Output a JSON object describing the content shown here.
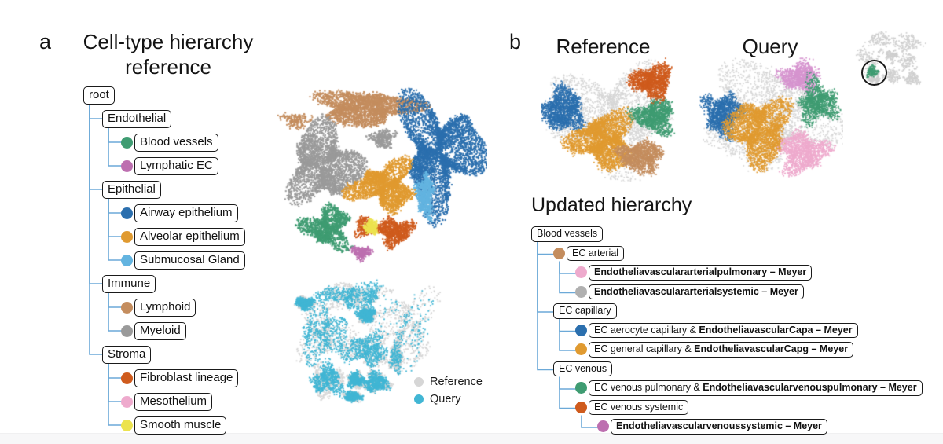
{
  "figure": {
    "panel_a_letter": "a",
    "panel_b_letter": "b",
    "title_a": "Cell-type hierarchy\nreference",
    "title_reference": "Reference",
    "title_query": "Query",
    "title_updated": "Updated hierarchy"
  },
  "legend": {
    "items": [
      {
        "label": "Reference",
        "color": "#d6d6d6"
      },
      {
        "label": "Query",
        "color": "#41b6d4"
      }
    ]
  },
  "palette": {
    "blood_vessels_green": "#3f9c72",
    "lymphatic_magenta": "#bd6fb0",
    "airway_blue": "#2b6fae",
    "alveolar_orange": "#e09a30",
    "submucosal_lightblue": "#63b4e0",
    "lymphoid_tan": "#c48d5e",
    "myeloid_gray": "#9a9a9a",
    "fibroblast_darkorange": "#cf5b1d",
    "mesothelium_pink": "#eeaacd",
    "smooth_muscle_yellow": "#ece34f",
    "ec_arterial_tan": "#c48d5e",
    "ec_arterial_pulm_pink": "#eeaacd",
    "ec_arterial_sys_gray": "#b0b0b0",
    "ec_aerocyte_blue": "#2b6fae",
    "ec_general_orange": "#e09a30",
    "ec_venous_pulm_green": "#3f9c72",
    "ec_venous_sys_orange": "#cf5b1d",
    "ec_venous_sys_meyer_magenta": "#bd6fb0",
    "tree_line": "#6ca9d8",
    "node_border": "#1a1a1a",
    "reference_gray": "#d6d6d6",
    "query_cyan": "#41b6d4"
  },
  "hierarchy_a": {
    "root": "root",
    "nodes": [
      {
        "id": "root",
        "label": "root",
        "level": 0,
        "dot": null
      },
      {
        "id": "endothelial",
        "label": "Endothelial",
        "level": 1,
        "dot": null
      },
      {
        "id": "blood",
        "label": "Blood vessels",
        "level": 2,
        "dot": "#3f9c72"
      },
      {
        "id": "lymphec",
        "label": "Lymphatic EC",
        "level": 2,
        "dot": "#bd6fb0"
      },
      {
        "id": "epithelial",
        "label": "Epithelial",
        "level": 1,
        "dot": null
      },
      {
        "id": "airway",
        "label": "Airway epithelium",
        "level": 2,
        "dot": "#2b6fae"
      },
      {
        "id": "alveolar",
        "label": "Alveolar epithelium",
        "level": 2,
        "dot": "#e09a30"
      },
      {
        "id": "submucosal",
        "label": "Submucosal Gland",
        "level": 2,
        "dot": "#63b4e0"
      },
      {
        "id": "immune",
        "label": "Immune",
        "level": 1,
        "dot": null
      },
      {
        "id": "lymphoid",
        "label": "Lymphoid",
        "level": 2,
        "dot": "#c48d5e"
      },
      {
        "id": "myeloid",
        "label": "Myeloid",
        "level": 2,
        "dot": "#9a9a9a"
      },
      {
        "id": "stroma",
        "label": "Stroma",
        "level": 1,
        "dot": null
      },
      {
        "id": "fibroblast",
        "label": "Fibroblast lineage",
        "level": 2,
        "dot": "#cf5b1d"
      },
      {
        "id": "mesothelium",
        "label": "Mesothelium",
        "level": 2,
        "dot": "#eeaacd"
      },
      {
        "id": "smooth",
        "label": "Smooth muscle",
        "level": 2,
        "dot": "#ece34f"
      }
    ]
  },
  "hierarchy_b": {
    "root": "Blood vessels",
    "nodes": [
      {
        "id": "bv",
        "label": "Blood vessels",
        "bold_label": "",
        "level": 0,
        "dot": null
      },
      {
        "id": "arterial",
        "label": "EC arterial",
        "bold_label": "",
        "level": 1,
        "dot": "#c48d5e"
      },
      {
        "id": "art-pulm",
        "label": "",
        "bold_label": "Endotheliavasculararterialpulmonary – Meyer",
        "level": 2,
        "dot": "#eeaacd"
      },
      {
        "id": "art-sys",
        "label": "",
        "bold_label": "Endotheliavasculararterialsystemic – Meyer",
        "level": 2,
        "dot": "#b0b0b0"
      },
      {
        "id": "capillary",
        "label": "EC capillary",
        "bold_label": "",
        "level": 1,
        "dot": null
      },
      {
        "id": "aerocyte",
        "label": "EC aerocyte capillary & ",
        "bold_label": "EndotheliavascularCapa – Meyer",
        "level": 2,
        "dot": "#2b6fae"
      },
      {
        "id": "general",
        "label": "EC general capillary & ",
        "bold_label": "EndotheliavascularCapg – Meyer",
        "level": 2,
        "dot": "#e09a30"
      },
      {
        "id": "venous",
        "label": "EC venous",
        "bold_label": "",
        "level": 1,
        "dot": null
      },
      {
        "id": "ven-pulm",
        "label": "EC venous pulmonary & ",
        "bold_label": "Endotheliavascularvenouspulmonary – Meyer",
        "level": 2,
        "dot": "#3f9c72"
      },
      {
        "id": "ven-sys",
        "label": "EC venous systemic",
        "bold_label": "",
        "level": 2,
        "dot": "#cf5b1d"
      },
      {
        "id": "ven-sys-m",
        "label": "",
        "bold_label": "Endotheliavascularvenoussystemic – Meyer",
        "level": 3,
        "dot": "#bd6fb0"
      }
    ]
  },
  "chart_data": [
    {
      "id": "umap-a-reference",
      "type": "scatter",
      "title": "",
      "xlabel": "",
      "ylabel": "",
      "description": "UMAP of reference atlas coloured by coarse cell-type",
      "clusters": [
        {
          "name": "Lymphoid",
          "color": "#c48d5e",
          "cx": 0.42,
          "cy": 0.12,
          "rx": 0.22,
          "ry": 0.085,
          "n": 2600
        },
        {
          "name": "Lymphoid-small",
          "color": "#c48d5e",
          "cx": 0.09,
          "cy": 0.19,
          "rx": 0.055,
          "ry": 0.035,
          "n": 180
        },
        {
          "name": "Myeloid",
          "color": "#9a9a9a",
          "cx": 0.22,
          "cy": 0.43,
          "rx": 0.155,
          "ry": 0.2,
          "n": 3000
        },
        {
          "name": "Myeloid-small",
          "color": "#9a9a9a",
          "cx": 0.5,
          "cy": 0.29,
          "rx": 0.055,
          "ry": 0.045,
          "n": 320
        },
        {
          "name": "Airway epithelium",
          "color": "#2b6fae",
          "cx": 0.77,
          "cy": 0.37,
          "rx": 0.17,
          "ry": 0.26,
          "n": 4200
        },
        {
          "name": "Submucosal Gland",
          "color": "#63b4e0",
          "cx": 0.7,
          "cy": 0.6,
          "rx": 0.035,
          "ry": 0.11,
          "n": 700
        },
        {
          "name": "Alveolar epithelium",
          "color": "#e09a30",
          "cx": 0.51,
          "cy": 0.55,
          "rx": 0.13,
          "ry": 0.11,
          "n": 2400
        },
        {
          "name": "Blood vessels",
          "color": "#3f9c72",
          "cx": 0.24,
          "cy": 0.78,
          "rx": 0.095,
          "ry": 0.1,
          "n": 1500
        },
        {
          "name": "Fibroblast lineage",
          "color": "#cf5b1d",
          "cx": 0.56,
          "cy": 0.8,
          "rx": 0.075,
          "ry": 0.065,
          "n": 900
        },
        {
          "name": "Fibroblast-small",
          "color": "#cf5b1d",
          "cx": 0.42,
          "cy": 0.78,
          "rx": 0.04,
          "ry": 0.045,
          "n": 300
        },
        {
          "name": "Smooth muscle",
          "color": "#ece34f",
          "cx": 0.445,
          "cy": 0.775,
          "rx": 0.028,
          "ry": 0.035,
          "n": 260
        },
        {
          "name": "Lymphatic EC",
          "color": "#bd6fb0",
          "cx": 0.4,
          "cy": 0.915,
          "rx": 0.045,
          "ry": 0.025,
          "n": 240
        }
      ]
    },
    {
      "id": "umap-a-query",
      "type": "scatter",
      "title": "",
      "description": "UMAP of the same embedding coloured by dataset origin",
      "clusters": [
        {
          "name": "Reference",
          "color": "#d6d6d6",
          "n": 5200
        },
        {
          "name": "Query",
          "color": "#41b6d4",
          "n": 5200
        }
      ]
    },
    {
      "id": "umap-b-reference",
      "type": "scatter",
      "title": "Reference",
      "description": "Endothelial sub-UMAP, reference cells coloured by EC subtype",
      "clusters": [
        {
          "name": "grey-background",
          "color": "#d6d6d6",
          "cx": 0.5,
          "cy": 0.47,
          "rx": 0.4,
          "ry": 0.36,
          "n": 2600
        },
        {
          "name": "EC arterial-blue",
          "color": "#2b6fae",
          "cx": 0.15,
          "cy": 0.42,
          "rx": 0.13,
          "ry": 0.16,
          "n": 1700
        },
        {
          "name": "EC general-orange",
          "color": "#e09a30",
          "cx": 0.43,
          "cy": 0.66,
          "rx": 0.19,
          "ry": 0.2,
          "n": 3200
        },
        {
          "name": "EC venous-tan",
          "color": "#c48d5e",
          "cx": 0.68,
          "cy": 0.79,
          "rx": 0.14,
          "ry": 0.11,
          "n": 1500
        },
        {
          "name": "EC venous pulm-green",
          "color": "#3f9c72",
          "cx": 0.78,
          "cy": 0.47,
          "rx": 0.12,
          "ry": 0.12,
          "n": 1400
        },
        {
          "name": "EC venous sys-red",
          "color": "#cf5b1d",
          "cx": 0.76,
          "cy": 0.19,
          "rx": 0.13,
          "ry": 0.11,
          "n": 1500
        }
      ]
    },
    {
      "id": "umap-b-query",
      "type": "scatter",
      "title": "Query",
      "description": "Endothelial sub-UMAP, query cells mapped onto reference",
      "clusters": [
        {
          "name": "grey-background",
          "color": "#d6d6d6",
          "cx": 0.5,
          "cy": 0.47,
          "rx": 0.42,
          "ry": 0.38,
          "n": 2400
        },
        {
          "name": "arterial-blue",
          "color": "#2b6fae",
          "cx": 0.17,
          "cy": 0.45,
          "rx": 0.12,
          "ry": 0.15,
          "n": 1500
        },
        {
          "name": "capillary-orange",
          "color": "#e09a30",
          "cx": 0.42,
          "cy": 0.58,
          "rx": 0.19,
          "ry": 0.24,
          "n": 2900
        },
        {
          "name": "mesothelium-pink",
          "color": "#eeaacd",
          "cx": 0.72,
          "cy": 0.76,
          "rx": 0.15,
          "ry": 0.14,
          "n": 1500
        },
        {
          "name": "lymphatic-magenta",
          "color": "#d694cf",
          "cx": 0.7,
          "cy": 0.16,
          "rx": 0.12,
          "ry": 0.1,
          "n": 1100
        },
        {
          "name": "venous-green",
          "color": "#3f9c72",
          "cx": 0.82,
          "cy": 0.36,
          "rx": 0.12,
          "ry": 0.14,
          "n": 1200
        }
      ]
    },
    {
      "id": "umap-b-inset",
      "type": "scatter",
      "title": "",
      "description": "Whole-atlas UMAP thumbnail with the endothelial compartment circled",
      "clusters": [
        {
          "name": "atlas-grey",
          "color": "#cfcfcf",
          "n": 900
        },
        {
          "name": "highlighted",
          "color": "#3f9c72",
          "n": 120
        }
      ]
    }
  ]
}
